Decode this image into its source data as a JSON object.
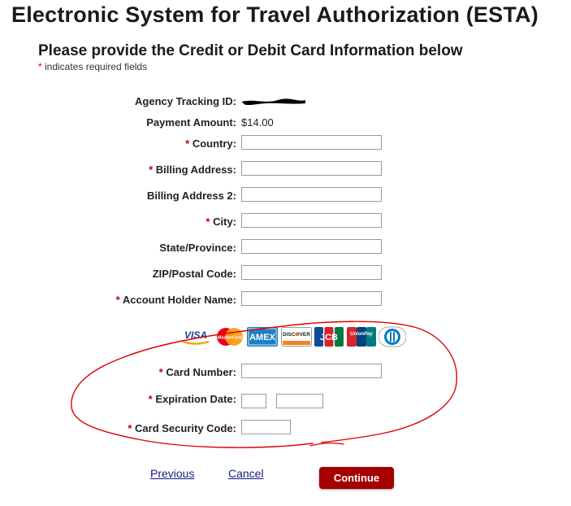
{
  "header": {
    "title": "Electronic System for Travel Authorization (ESTA)",
    "subtitle": "Please provide the Credit or Debit Card Information below",
    "required_star": "*",
    "required_note": " indicates required fields"
  },
  "form": {
    "agency_tracking_label": "Agency Tracking ID:",
    "payment_amount_label": "Payment Amount:",
    "payment_amount_value": "$14.00",
    "country_label": "Country:",
    "billing_address_label": "Billing Address:",
    "billing_address2_label": "Billing Address 2:",
    "city_label": "City:",
    "state_label": "State/Province:",
    "zip_label": "ZIP/Postal Code:",
    "account_holder_label": "Account Holder Name:",
    "card_number_label": "Card Number:",
    "expiration_label": "Expiration Date:",
    "security_code_label": "Card Security Code:",
    "required_star": "*"
  },
  "card_logos": {
    "visa": "VISA",
    "mastercard": "MasterCard",
    "amex": "AMEX",
    "discover": "DISCOVER",
    "jcb": "JCB",
    "unionpay": "UnionPay"
  },
  "actions": {
    "previous": "Previous",
    "cancel": "Cancel",
    "continue": "Continue"
  },
  "colors": {
    "required": "#c00000",
    "continue_button": "#a40000",
    "link": "#1a1a8c",
    "annotation_ink": "#e00000"
  }
}
